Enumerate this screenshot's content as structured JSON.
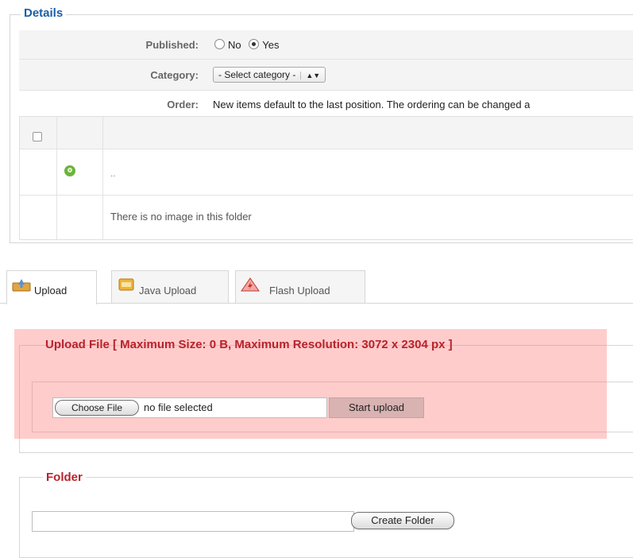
{
  "details": {
    "legend": "Details",
    "published": {
      "label": "Published:",
      "options": [
        "No",
        "Yes"
      ],
      "selected": "Yes"
    },
    "category": {
      "label": "Category:",
      "value": "- Select category -"
    },
    "order": {
      "label": "Order:",
      "text": "New items default to the last position. The ordering can be changed a"
    }
  },
  "table": {
    "parent_row_text": "..",
    "empty_message": "There is no image in this folder"
  },
  "tabs": [
    {
      "label": "Upload",
      "icon": "upload-icon",
      "active": true
    },
    {
      "label": "Java Upload",
      "icon": "java-icon",
      "active": false
    },
    {
      "label": "Flash Upload",
      "icon": "flash-icon",
      "active": false
    }
  ],
  "upload": {
    "legend": "Upload File [ Maximum Size: 0 B, Maximum Resolution: 3072 x 2304 px ]",
    "choose_file_label": "Choose File",
    "file_status": "no file selected",
    "start_label": "Start upload",
    "highlight_color": "#ff7878"
  },
  "folder": {
    "legend": "Folder",
    "input_value": "",
    "create_label": "Create Folder"
  },
  "colors": {
    "legend_blue": "#1a5ea8",
    "legend_red": "#b8232b"
  }
}
